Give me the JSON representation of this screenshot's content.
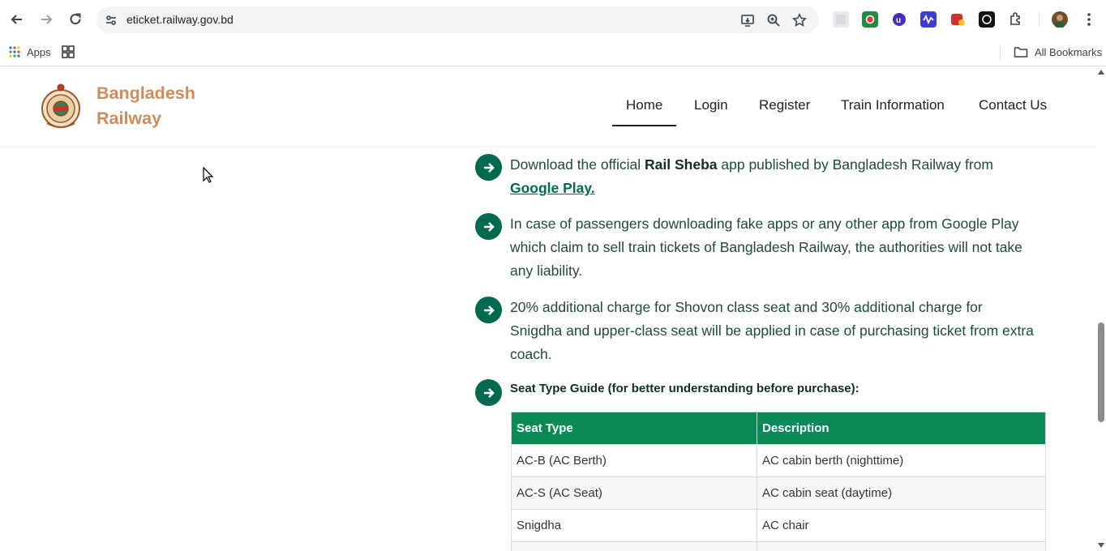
{
  "browser": {
    "url": "eticket.railway.gov.bd",
    "bookmarks": {
      "apps_label": "Apps",
      "all_bookmarks_label": "All Bookmarks"
    }
  },
  "site": {
    "brand_line1": "Bangladesh",
    "brand_line2": "Railway",
    "nav": [
      {
        "label": "Home",
        "active": true
      },
      {
        "label": "Login"
      },
      {
        "label": "Register"
      },
      {
        "label": "Train Information"
      },
      {
        "label": "Contact Us"
      }
    ]
  },
  "notices": {
    "item1": {
      "pre": "Download the official ",
      "bold": "Rail Sheba",
      "post": " app published by Bangladesh Railway from ",
      "link": "Google Play."
    },
    "item2": "In case of passengers downloading fake apps or any other app from Google Play which claim to sell train tickets of Bangladesh Railway, the authorities will not take any liability.",
    "item3": "20% additional charge for Shovon class seat and 30% additional charge for Snigdha and upper-class seat will be applied in case of purchasing ticket from extra coach.",
    "item4": "Seat Type Guide (for better understanding before purchase):"
  },
  "seat_table": {
    "headers": [
      "Seat Type",
      "Description"
    ],
    "rows": [
      [
        "AC-B (AC Berth)",
        "AC cabin berth (nighttime)"
      ],
      [
        "AC-S (AC Seat)",
        "AC cabin seat (daytime)"
      ],
      [
        "Snigdha",
        "AC chair"
      ]
    ]
  },
  "colors": {
    "accent": "#006a4e",
    "table_header": "#0b8a58",
    "brand": "#d08b5b"
  }
}
